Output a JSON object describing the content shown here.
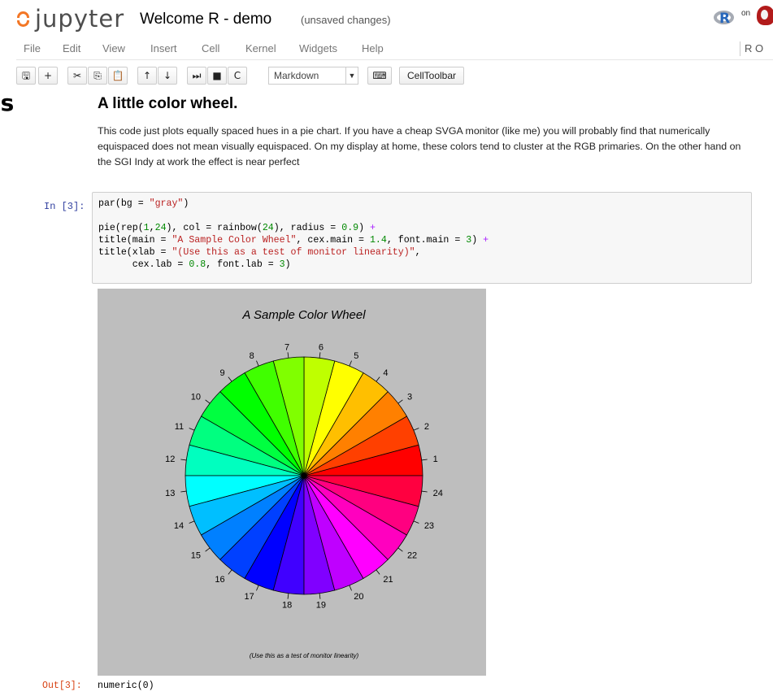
{
  "header": {
    "app_name": "jupyter",
    "notebook_title": "Welcome R - demo",
    "save_status": "(unsaved changes)",
    "kernel_logo_letter": "R",
    "kernel_on_text": "on"
  },
  "menubar": {
    "items": [
      "File",
      "Edit",
      "View",
      "Insert",
      "Cell",
      "Kernel",
      "Widgets",
      "Help"
    ],
    "kernel_indicator": "R O"
  },
  "toolbar": {
    "buttons": [
      {
        "name": "save-icon",
        "glyph": "🖫"
      },
      {
        "name": "add-cell-icon",
        "glyph": "+"
      },
      {
        "name": "cut-icon",
        "glyph": "✂"
      },
      {
        "name": "copy-icon",
        "glyph": "⎘"
      },
      {
        "name": "paste-icon",
        "glyph": "📋"
      },
      {
        "name": "move-up-icon",
        "glyph": "↑"
      },
      {
        "name": "move-down-icon",
        "glyph": "↓"
      },
      {
        "name": "run-icon",
        "glyph": "⏭"
      },
      {
        "name": "stop-icon",
        "glyph": "■"
      },
      {
        "name": "restart-icon",
        "glyph": "C"
      }
    ],
    "cell_type_value": "Markdown",
    "keyboard_icon": "⌨",
    "celltoolbar_label": "CellToolbar"
  },
  "bleed_text": "is",
  "markdown_cell": {
    "heading": "A little color wheel.",
    "paragraph": "This code just plots equally spaced hues in a pie chart. If you have a cheap SVGA monitor (like me) you will probably find that numerically equispaced does not mean visually equispaced. On my display at home, these colors tend to cluster at the RGB primaries. On the other hand on the SGI Indy at work the effect is near perfect"
  },
  "code_cell": {
    "prompt": "In [3]:",
    "lines": [
      [
        {
          "t": "par(bg = "
        },
        {
          "t": "\"gray\"",
          "c": "str"
        },
        {
          "t": ")"
        }
      ],
      [],
      [
        {
          "t": "pie(rep("
        },
        {
          "t": "1",
          "c": "num"
        },
        {
          "t": ","
        },
        {
          "t": "24",
          "c": "num"
        },
        {
          "t": "), col = rainbow("
        },
        {
          "t": "24",
          "c": "num"
        },
        {
          "t": "), radius = "
        },
        {
          "t": "0.9",
          "c": "num"
        },
        {
          "t": ") "
        },
        {
          "t": "+",
          "c": "op"
        }
      ],
      [
        {
          "t": "title(main = "
        },
        {
          "t": "\"A Sample Color Wheel\"",
          "c": "str"
        },
        {
          "t": ", cex.main = "
        },
        {
          "t": "1.4",
          "c": "num"
        },
        {
          "t": ", font.main = "
        },
        {
          "t": "3",
          "c": "num"
        },
        {
          "t": ") "
        },
        {
          "t": "+",
          "c": "op"
        }
      ],
      [
        {
          "t": "title(xlab = "
        },
        {
          "t": "\"(Use this as a test of monitor linearity)\"",
          "c": "str"
        },
        {
          "t": ","
        }
      ],
      [
        {
          "t": "      cex.lab = "
        },
        {
          "t": "0.8",
          "c": "num"
        },
        {
          "t": ", font.lab = "
        },
        {
          "t": "3",
          "c": "num"
        },
        {
          "t": ")"
        }
      ]
    ]
  },
  "output": {
    "prompt": "Out[3]:",
    "text": "numeric(0)"
  },
  "chart_data": {
    "type": "pie",
    "title": "A Sample Color Wheel",
    "xlabel": "(Use this as a test of monitor linearity)",
    "background": "#bebebe",
    "categories": [
      "1",
      "2",
      "3",
      "4",
      "5",
      "6",
      "7",
      "8",
      "9",
      "10",
      "11",
      "12",
      "13",
      "14",
      "15",
      "16",
      "17",
      "18",
      "19",
      "20",
      "21",
      "22",
      "23",
      "24"
    ],
    "values": [
      1,
      1,
      1,
      1,
      1,
      1,
      1,
      1,
      1,
      1,
      1,
      1,
      1,
      1,
      1,
      1,
      1,
      1,
      1,
      1,
      1,
      1,
      1,
      1
    ],
    "colors": [
      "#FF0000",
      "#FF4000",
      "#FF8000",
      "#FFBF00",
      "#FFFF00",
      "#BFFF00",
      "#80FF00",
      "#40FF00",
      "#00FF00",
      "#00FF40",
      "#00FF80",
      "#00FFBF",
      "#00FFFF",
      "#00BFFF",
      "#0080FF",
      "#0040FF",
      "#0000FF",
      "#4000FF",
      "#8000FF",
      "#BF00FF",
      "#FF00FF",
      "#FF00BF",
      "#FF0080",
      "#FF0040"
    ],
    "start_angle_deg": 0,
    "direction": "counterclockwise"
  }
}
